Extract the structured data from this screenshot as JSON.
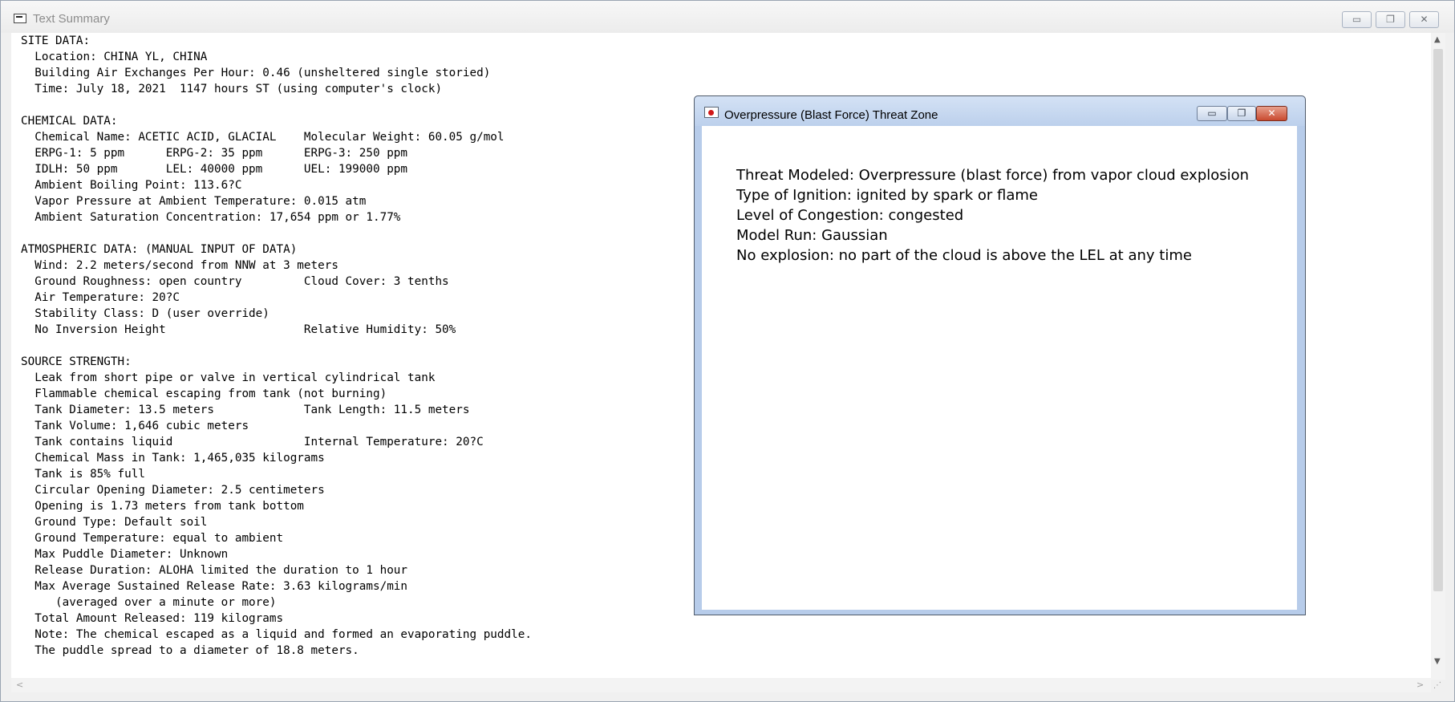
{
  "window": {
    "title": "Text Summary",
    "minimize_label": "▭",
    "maximize_label": "❐",
    "close_label": "✕"
  },
  "summary_lines": [
    "SITE DATA:",
    "  Location: CHINA YL, CHINA",
    "  Building Air Exchanges Per Hour: 0.46 (unsheltered single storied)",
    "  Time: July 18, 2021  1147 hours ST (using computer's clock)",
    "",
    "CHEMICAL DATA:",
    "  Chemical Name: ACETIC ACID, GLACIAL    Molecular Weight: 60.05 g/mol",
    "  ERPG-1: 5 ppm      ERPG-2: 35 ppm      ERPG-3: 250 ppm",
    "  IDLH: 50 ppm       LEL: 40000 ppm      UEL: 199000 ppm",
    "  Ambient Boiling Point: 113.6?C",
    "  Vapor Pressure at Ambient Temperature: 0.015 atm",
    "  Ambient Saturation Concentration: 17,654 ppm or 1.77%",
    "",
    "ATMOSPHERIC DATA: (MANUAL INPUT OF DATA)",
    "  Wind: 2.2 meters/second from NNW at 3 meters",
    "  Ground Roughness: open country         Cloud Cover: 3 tenths",
    "  Air Temperature: 20?C",
    "  Stability Class: D (user override)",
    "  No Inversion Height                    Relative Humidity: 50%",
    "",
    "SOURCE STRENGTH:",
    "  Leak from short pipe or valve in vertical cylindrical tank",
    "  Flammable chemical escaping from tank (not burning)",
    "  Tank Diameter: 13.5 meters             Tank Length: 11.5 meters",
    "  Tank Volume: 1,646 cubic meters",
    "  Tank contains liquid                   Internal Temperature: 20?C",
    "  Chemical Mass in Tank: 1,465,035 kilograms",
    "  Tank is 85% full",
    "  Circular Opening Diameter: 2.5 centimeters",
    "  Opening is 1.73 meters from tank bottom",
    "  Ground Type: Default soil",
    "  Ground Temperature: equal to ambient",
    "  Max Puddle Diameter: Unknown",
    "  Release Duration: ALOHA limited the duration to 1 hour",
    "  Max Average Sustained Release Rate: 3.63 kilograms/min",
    "     (averaged over a minute or more)",
    "  Total Amount Released: 119 kilograms",
    "  Note: The chemical escaped as a liquid and formed an evaporating puddle.",
    "  The puddle spread to a diameter of 18.8 meters."
  ],
  "dialog": {
    "title": "Overpressure (Blast Force) Threat Zone",
    "minimize_label": "▭",
    "maximize_label": "❐",
    "close_label": "✕",
    "lines": [
      "Threat Modeled: Overpressure (blast force) from vapor cloud explosion",
      "Type of Ignition: ignited by spark or flame",
      "Level of Congestion: congested",
      "Model Run: Gaussian",
      "No explosion: no part of the cloud is above the LEL at any time"
    ]
  },
  "scrollbars": {
    "up_arrow": "▲",
    "down_arrow": "▼",
    "left_arrow": "<",
    "right_arrow": ">",
    "grip": "⋰"
  }
}
